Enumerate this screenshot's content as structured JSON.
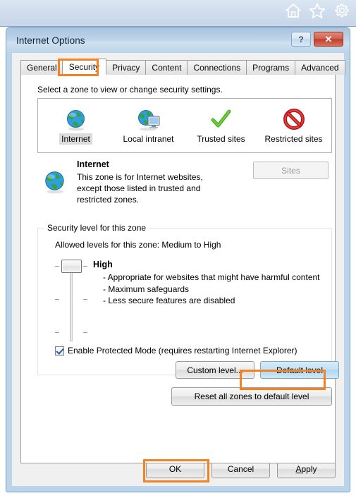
{
  "browser_toolbar": {
    "icons": [
      {
        "name": "home-icon",
        "label": "Home"
      },
      {
        "name": "favorites-star-icon",
        "label": "Favorites"
      },
      {
        "name": "tools-gear-icon",
        "label": "Tools"
      }
    ]
  },
  "dialog": {
    "title": "Internet Options",
    "help_button": "?",
    "close_button": "✕"
  },
  "tabs": [
    {
      "label": "General",
      "selected": false
    },
    {
      "label": "Security",
      "selected": true
    },
    {
      "label": "Privacy",
      "selected": false
    },
    {
      "label": "Content",
      "selected": false
    },
    {
      "label": "Connections",
      "selected": false
    },
    {
      "label": "Programs",
      "selected": false
    },
    {
      "label": "Advanced",
      "selected": false
    }
  ],
  "security_tab": {
    "zone_prompt": "Select a zone to view or change security settings.",
    "zones": [
      {
        "label": "Internet",
        "icon": "globe-icon",
        "selected": true
      },
      {
        "label": "Local intranet",
        "icon": "globe-monitor-icon",
        "selected": false
      },
      {
        "label": "Trusted sites",
        "icon": "green-check-icon",
        "selected": false
      },
      {
        "label": "Restricted sites",
        "icon": "red-prohibited-icon",
        "selected": false
      }
    ],
    "zone_description": {
      "icon": "globe-icon",
      "title": "Internet",
      "line1": "This zone is for Internet websites,",
      "line2": "except those listed in trusted and",
      "line3": "restricted zones."
    },
    "sites_button": {
      "label": "Sites",
      "enabled": false
    },
    "security_level": {
      "group_title": "Security level for this zone",
      "allowed_levels": "Allowed levels for this zone: Medium to High",
      "level_name": "High",
      "bullets": [
        "- Appropriate for websites that might have harmful content",
        "- Maximum safeguards",
        "- Less secure features are disabled"
      ],
      "slider": {
        "name": "security-level-slider",
        "orientation": "vertical",
        "thumb_position": "top",
        "tick_count": 3
      }
    },
    "protected_mode": {
      "label": "Enable Protected Mode (requires restarting Internet Explorer)",
      "checked": true
    },
    "custom_level_button": "Custom level...",
    "default_level_button": "Default level",
    "reset_button": "Reset all zones to default level"
  },
  "footer": {
    "ok_button": "OK",
    "cancel_button": "Cancel",
    "apply_button_prefix": "A",
    "apply_button_rest": "pply"
  },
  "annotations": {
    "color": "#f58220",
    "targets": [
      "Security tab",
      "Default level button",
      "OK button"
    ]
  }
}
